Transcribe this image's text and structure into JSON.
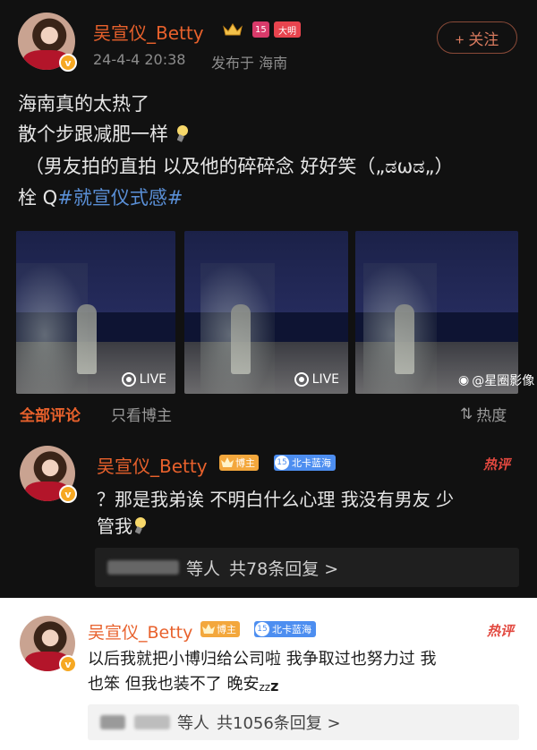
{
  "post": {
    "author": "吴宣仪_Betty",
    "level_badge": "大明",
    "date": "24-4-4 20:38",
    "location": "发布于 海南",
    "follow_label": "+ 关注",
    "lines": [
      "海南真的太热了",
      "散个步跟减肥一样",
      "（男友拍的直拍 以及他的碎碎念 好好笑（„ಡωಡ„）"
    ],
    "last_line_prefix": "栓 Q",
    "hashtag": "#就宣仪式感#",
    "photos": [
      {
        "live_label": "LIVE"
      },
      {
        "live_label": "LIVE"
      },
      {
        "live_label": ""
      }
    ],
    "watermark": "@星圈影像"
  },
  "tabs": {
    "all": "全部评论",
    "author_only": "只看博主",
    "sort": "热度"
  },
  "comments": [
    {
      "author": "吴宣仪_Betty",
      "boss_tag": "博主",
      "fan_level": "15",
      "fan_tag": "北卡蓝海",
      "hot_label": "热评",
      "lines": [
        "？那是我弟诶 不明白什么心理 我没有男友 少",
        "管我"
      ],
      "reply_prefix": "等人",
      "reply_count": "共78条回复 >"
    },
    {
      "author": "吴宣仪_Betty",
      "boss_tag": "博主",
      "fan_level": "15",
      "fan_tag": "北卡蓝海",
      "hot_label": "热评",
      "lines": [
        "以后我就把小博归给公司啦 我争取过也努力过 我",
        "也笨 但我也装不了 晚安"
      ],
      "reply_prefix": "等人",
      "reply_count": "共1056条回复 >"
    }
  ],
  "colors": {
    "accent": "#e8612c",
    "hashtag": "#5a8fd6",
    "hot": "#e2483f",
    "fan_tag": "#4d8ef0",
    "boss_tag": "#f3a73c"
  }
}
